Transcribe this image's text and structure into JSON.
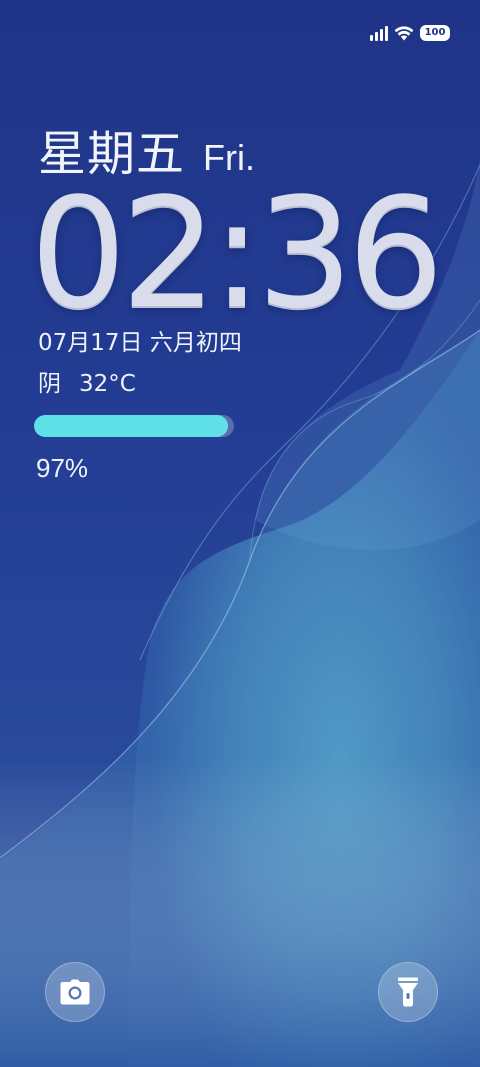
{
  "status_bar": {
    "signal_icon": "cellular-signal-icon",
    "wifi_icon": "wifi-icon",
    "battery_level": "100"
  },
  "lock_screen": {
    "weekday_cn": "星期五",
    "weekday_en": "Fri.",
    "time": "02:36",
    "date": "07月17日 六月初四",
    "weather_condition": "阴",
    "temperature": "32°C",
    "charging_percent_text": "97%",
    "charging_level": 0.97
  },
  "shortcuts": {
    "camera_icon": "camera-icon",
    "flashlight_icon": "flashlight-icon"
  },
  "colors": {
    "wallpaper_top": "#1f3488",
    "wallpaper_wave": "#5fb4d4",
    "charge_bar": "#5fe0e6"
  }
}
